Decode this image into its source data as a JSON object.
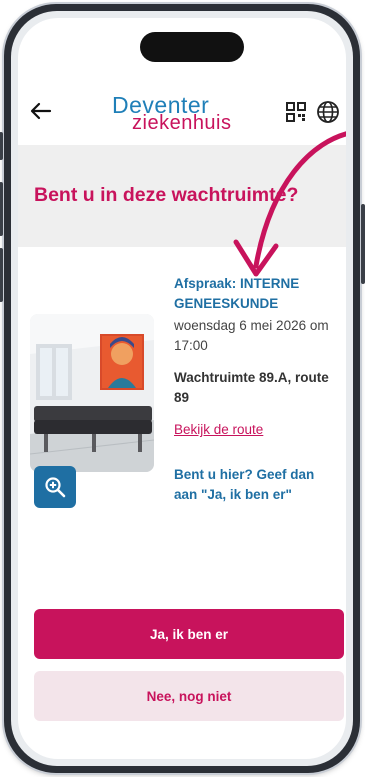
{
  "header": {
    "logo_line1": "Deventer",
    "logo_line2": "ziekenhuis"
  },
  "banner": {
    "title": "Bent u in deze wachtruimte?"
  },
  "appointment": {
    "label": "Afspraak: INTERNE GENEESKUNDE",
    "date": "woensdag 6 mei 2026 om 17:00",
    "location": "Wachtruimte 89.A, route 89",
    "route_link": "Bekijk de route",
    "question": "Bent u hier? Geef dan aan \"Ja, ik ben er\""
  },
  "actions": {
    "yes_label": "Ja, ik ben er",
    "no_label": "Nee, nog niet"
  },
  "icons": {
    "back": "arrow-left-icon",
    "qr": "qr-code-icon",
    "language": "globe-icon",
    "zoom": "zoom-in-icon"
  },
  "colors": {
    "brand_magenta": "#c8135c",
    "brand_blue": "#1f7fb8",
    "info_blue": "#1f6fa3",
    "banner_bg": "#efefef",
    "secondary_button_bg": "#f3e4ea"
  }
}
